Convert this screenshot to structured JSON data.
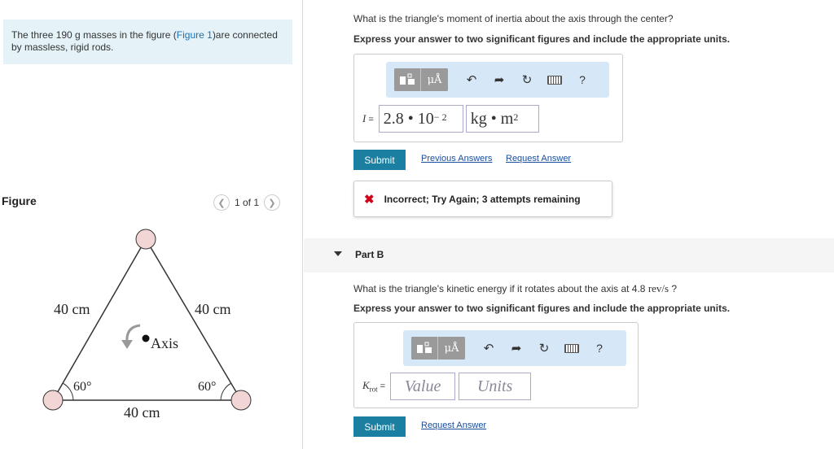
{
  "problem": {
    "intro_before_link": "The three 190 g masses in the figure (",
    "intro_link": "Figure 1",
    "intro_after_link": ")are connected by massless, rigid rods."
  },
  "figure_panel": {
    "title": "Figure",
    "pager_text": "1 of 1",
    "prev_icon": "chevron-left-icon",
    "next_icon": "chevron-right-icon",
    "labels": {
      "left_side": "40 cm",
      "right_side": "40 cm",
      "bottom_side": "40 cm",
      "left_angle": "60°",
      "right_angle": "60°",
      "axis": "Axis"
    }
  },
  "part_a": {
    "question": "What is the triangle's moment of inertia about the axis through the center?",
    "instruction": "Express your answer to two significant figures and include the appropriate units.",
    "toolbar": {
      "templates_icon": "templates-icon",
      "units_label": "μÅ",
      "undo_icon": "undo-icon",
      "redo_icon": "redo-icon",
      "reset_icon": "reset-icon",
      "keyboard_icon": "keyboard-icon",
      "help_label": "?"
    },
    "variable": "I",
    "equals": "=",
    "value_mantissa": "2.8 • 10",
    "value_exponent": "− 2",
    "units_base": "kg • m",
    "units_exponent": "2",
    "submit_label": "Submit",
    "previous_answers_label": "Previous Answers",
    "request_answer_label": "Request Answer",
    "feedback_icon": "x-icon",
    "feedback_text": "Incorrect; Try Again; 3 attempts remaining"
  },
  "part_b": {
    "title": "Part B",
    "question_before": "What is the triangle's kinetic energy if it rotates about the axis at 4.8 ",
    "question_unit": "rev/s",
    "question_after": " ?",
    "instruction": "Express your answer to two significant figures and include the appropriate units.",
    "toolbar": {
      "templates_icon": "templates-icon",
      "units_label": "μÅ",
      "undo_icon": "undo-icon",
      "redo_icon": "redo-icon",
      "reset_icon": "reset-icon",
      "keyboard_icon": "keyboard-icon",
      "help_label": "?"
    },
    "variable": "K",
    "variable_sub": "rot",
    "equals": "=",
    "value_placeholder": "Value",
    "units_placeholder": "Units",
    "submit_label": "Submit",
    "request_answer_label": "Request Answer"
  },
  "colors": {
    "intro_bg": "#e5f3f9",
    "toolbar_bg": "#d6e8f7",
    "submit_bg": "#1a7fa0",
    "link": "#1a4d9a",
    "error": "#d0021b",
    "mass_fill": "#f2d6d6"
  }
}
